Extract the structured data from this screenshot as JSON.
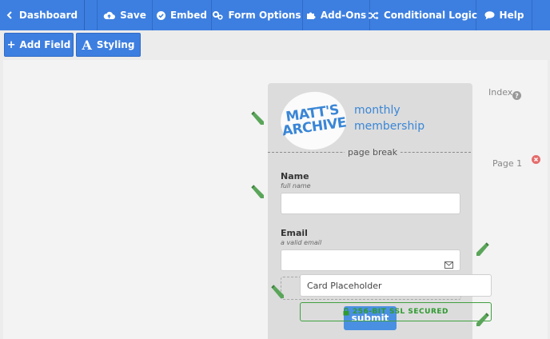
{
  "topnav": {
    "dashboard": "Dashboard",
    "save": "Save",
    "embed": "Embed",
    "form_options": "Form Options",
    "add_ons": "Add-Ons",
    "conditional_logic": "Conditional Logic",
    "help": "Help"
  },
  "toolbar": {
    "add_field": "Add Field",
    "add_field_prefix": "+",
    "styling": "Styling",
    "styling_glyph": "A"
  },
  "form": {
    "logo_line1": "MATT'S",
    "logo_line2": "ARCHIVE",
    "title": "monthly membership",
    "page_break_label": "page break",
    "fields": [
      {
        "label": "Name",
        "sublabel": "full name",
        "value": ""
      },
      {
        "label": "Email",
        "sublabel": "a valid email",
        "value": ""
      }
    ],
    "card_placeholder": "Card Placeholder",
    "ssl_text": "256-BIT SSL SECURED",
    "submit_label": "submit"
  },
  "sidebar": {
    "index_label": "Index",
    "page_label": "Page 1"
  },
  "colors": {
    "nav_blue": "#3d7fe0",
    "logo_blue": "#3a86d6",
    "ssl_green": "#2f9a2f",
    "pencil_green": "#5aa55a",
    "delete_red": "#e56b6b"
  }
}
